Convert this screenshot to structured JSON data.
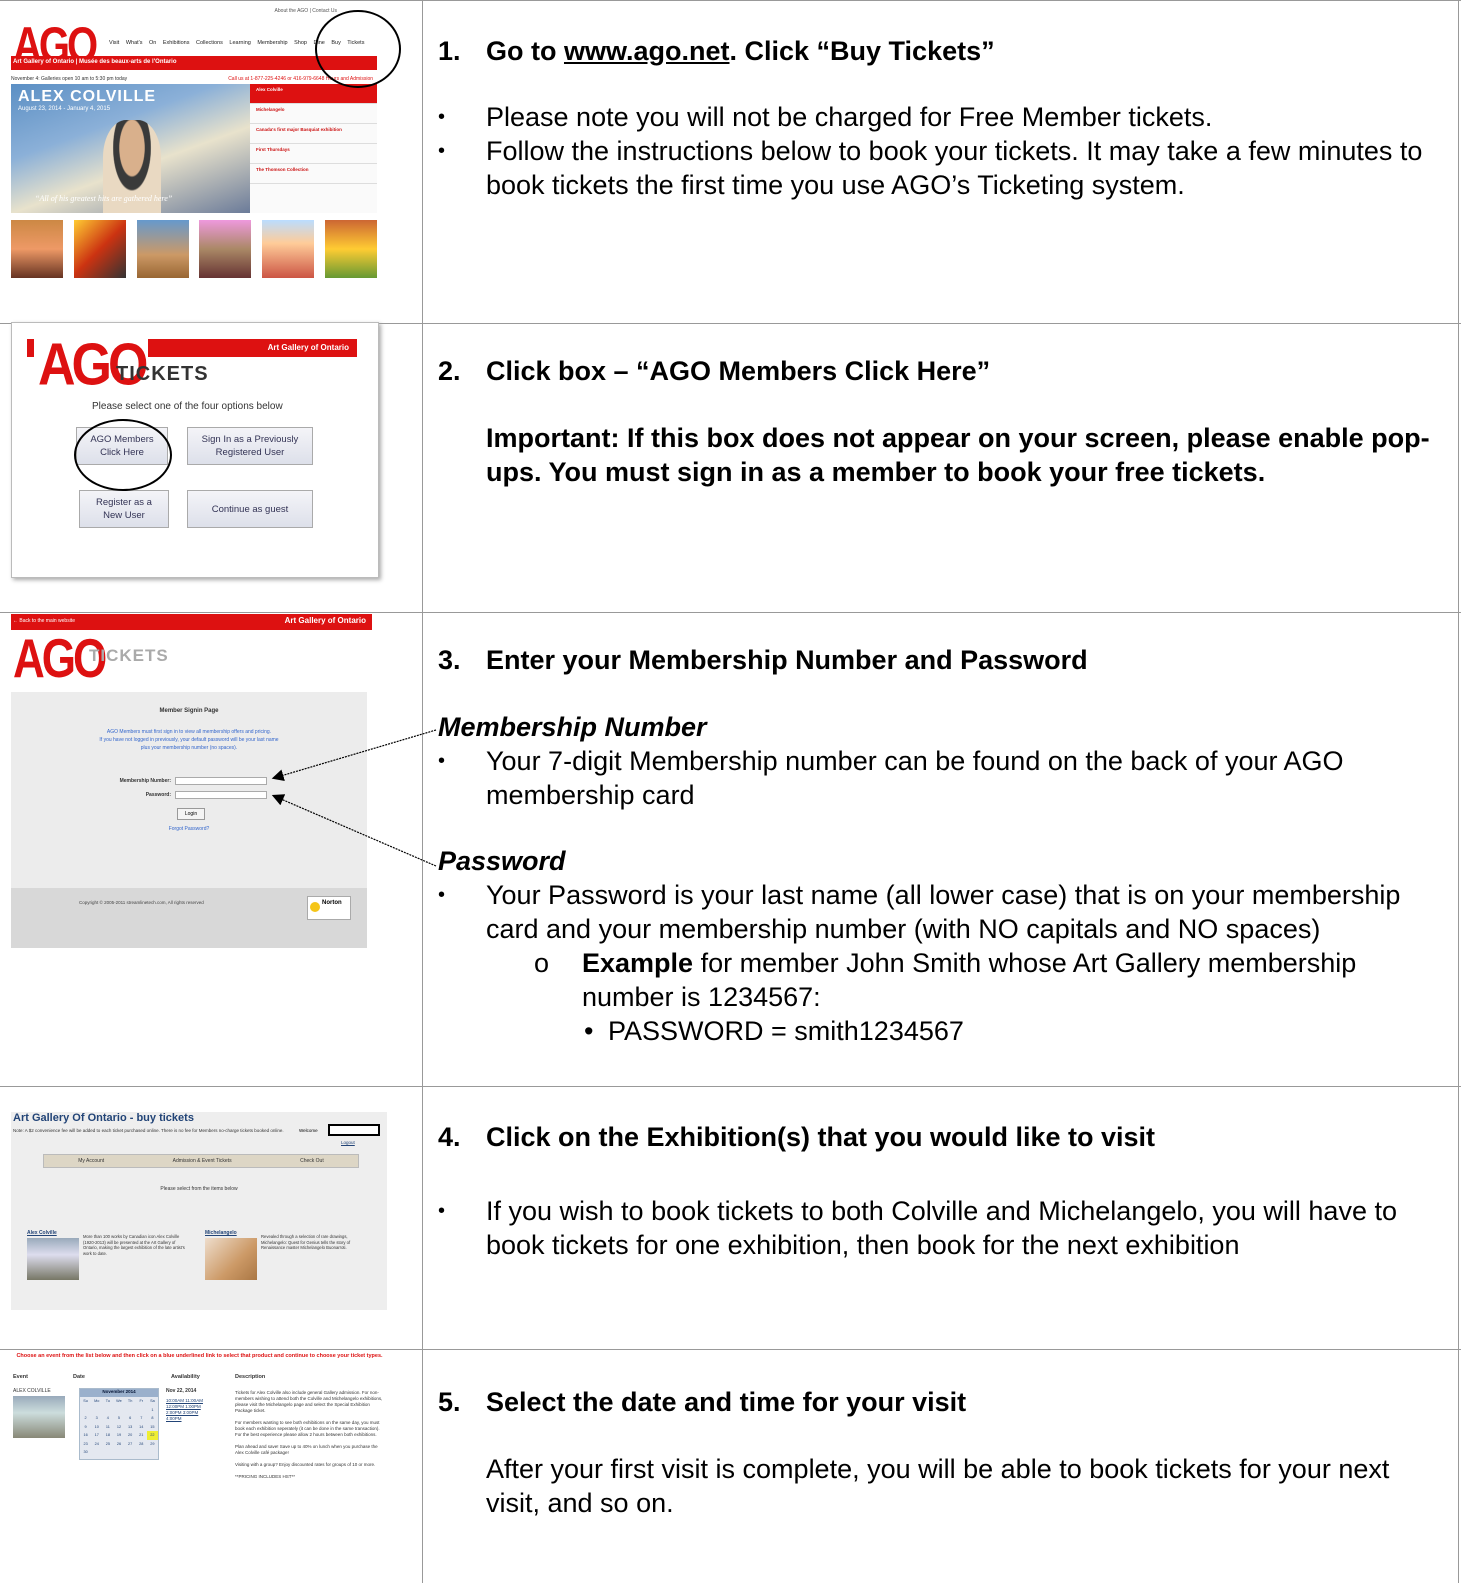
{
  "steps": {
    "s1": {
      "num": "1.",
      "title_pre": "Go to ",
      "title_link": "www.ago.net",
      "title_post": ". Click “Buy Tickets”",
      "bullets": [
        "Please note you will not be charged for Free Member tickets.",
        "Follow the instructions below to book your tickets.  It may take a few minutes to book tickets the first time you use AGO’s Ticketing system."
      ]
    },
    "s2": {
      "num": "2.",
      "title": "Click box – “AGO Members Click Here”",
      "important": "Important: If this box does not appear on your screen, please enable pop-ups.   You must sign in as a member to book your free tickets."
    },
    "s3": {
      "num": "3.",
      "title": "Enter your Membership Number and Password",
      "membership_head": "Membership Number",
      "membership_bullet": "Your 7-digit Membership number can be found on the back of your AGO membership card",
      "password_head": "Password",
      "password_bullet": "Your Password is your last name (all lower case) that is on your membership card and your membership number (with NO capitals and NO spaces)",
      "example_bold": "Example",
      "example_rest": " for member John Smith whose Art Gallery membership number is 1234567:",
      "example_value": "PASSWORD = smith1234567"
    },
    "s4": {
      "num": "4.",
      "title": "Click on the Exhibition(s) that you would like to visit",
      "bullet": "If you wish to book tickets to both Colville and Michelangelo, you will have to book tickets for one exhibition, then book for the next exhibition"
    },
    "s5": {
      "num": "5.",
      "title": "Select the date and time for your visit",
      "text": "After your first visit is complete, you will be able to book tickets for your next visit, and so on."
    }
  },
  "shots": {
    "s1": {
      "top_links": "About the AGO  |  Contact Us",
      "logo": "AGO",
      "nav": "Visit  What's On  Exhibitions  Collections  Learning  Membership  Shop  Dine  Buy Tickets",
      "redbar": "Art Gallery of Ontario | Musée des beaux-arts de l'Ontario",
      "sub": "November 4: Galleries open 10 am to 5:30 pm today",
      "sub2": "Call us at 1-877-225-4246 or 416-979-6648  Hours and Admission",
      "hero_title": "ALEX COLVILLE",
      "hero_dates": "August 23, 2014 - January 4, 2015",
      "hero_quote": "“All of his greatest hits are gathered here”",
      "side": [
        "Alex Colville",
        "Michelangelo",
        "Canada's first major Basquiat exhibition",
        "First Thursdays",
        "The Thomson Collection"
      ]
    },
    "s2": {
      "banner": "Art Gallery of Ontario",
      "logo": "AGO",
      "tickets": "TICKETS",
      "instr": "Please select one of the four options below",
      "b1": "AGO Members\nClick Here",
      "b2": "Sign In as a Previously\nRegistered User",
      "b3": "Register as a\nNew User",
      "b4": "Continue as guest"
    },
    "s3": {
      "back": "← Back to the main website",
      "banner": "Art Gallery of Ontario",
      "logo": "AGO",
      "tickets": "TICKETS",
      "title": "Member Signin Page",
      "note": "AGO Members must first sign in to view all membership offers and pricing.\nIf you have not logged in previously, your default password will be your last name\nplus your membership number (no spaces).",
      "label1": "Membership Number:",
      "label2": "Password:",
      "login": "Login",
      "forgot": "Forgot Password?",
      "copy": "Copyright © 2005-2011 streamlinetech.com, All rights reserved",
      "norton": "Norton"
    },
    "s4": {
      "head": "Art Gallery Of Ontario - buy tickets",
      "note": "Note: A $2 convenience fee will be added to each ticket purchased online. There is no fee for Members no-charge tickets booked online.",
      "welcome": "Welcome",
      "logout": "Logout",
      "nav": [
        "My Account",
        "Admission & Event Tickets",
        "Check Out"
      ],
      "select": "Please select from the items below",
      "ex1": "Alex Colville",
      "ex1_text": "More than 100 works by Canadian icon Alex Colville (1920-2013) will be presented at the Art Gallery of Ontario, making the largest exhibition of the late artist's work to date.",
      "ex2": "Michelangelo",
      "ex2_text": "Revealed through a selection of rare drawings, Michelangelo: Quest for Genius tells the story of Renaissance master Michelangelo Buonarroti."
    },
    "s5": {
      "warn": "Choose an event from the list below and then click on a blue underlined link to select that product and continue to choose your ticket types.",
      "cols": [
        "Event",
        "Date",
        "Availability",
        "Description"
      ],
      "event": "ALEX COLVILLE",
      "month": "November 2014",
      "days": [
        "Su",
        "Mo",
        "Tu",
        "We",
        "Th",
        "Fr",
        "Sa",
        "",
        "",
        "",
        "",
        "",
        "",
        "1",
        "2",
        "3",
        "4",
        "5",
        "6",
        "7",
        "8",
        "9",
        "10",
        "11",
        "12",
        "13",
        "14",
        "15",
        "16",
        "17",
        "18",
        "19",
        "20",
        "21",
        "22",
        "23",
        "24",
        "25",
        "26",
        "27",
        "28",
        "29",
        "30",
        "",
        "",
        "",
        "",
        "",
        ""
      ],
      "date": "Nov 22, 2014",
      "times": [
        "10:00AM  11:00AM",
        "12:00PM  1:00PM",
        "2:00PM  3:00PM",
        "4:00PM"
      ],
      "desc": [
        "Tickets for Alex Colville also include general Gallery admission. For non-members wishing to attend both the Colville and Michelangelo exhibitions, please visit the Michelangelo page and select the Special Exhibition Package ticket.",
        "For members wanting to see both exhibitions on the same day, you must book each exhibition seperately (it can be done in the same transaction). For the best experience please allow 2 hours between both exhibitions.",
        "Plan ahead and save! Save up to 40% on lunch when you purchase the Alex Colville café package!",
        "Visiting with a group? Enjoy discounted rates for groups of 10 or more.",
        "**PRICING INCLUDES HST**"
      ]
    }
  }
}
